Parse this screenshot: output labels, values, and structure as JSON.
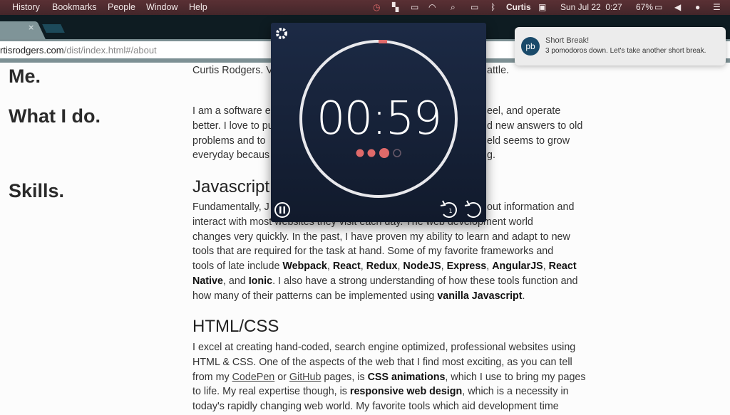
{
  "menubar": {
    "items": [
      "History",
      "Bookmarks",
      "People",
      "Window",
      "Help"
    ],
    "user": "Curtis",
    "datetime": "Sun Jul 22  0:27",
    "battery": "67%"
  },
  "browser": {
    "tab_close": "×",
    "url_host": "rtisrodgers.com",
    "url_path": "/dist/index.html#/about"
  },
  "sidebar": {
    "me": "Me.",
    "what": "What I do.",
    "skills": "Skills."
  },
  "content": {
    "intro": [
      {
        "l": "Curtis Rodgers. V",
        "r": "attle."
      }
    ],
    "what": [
      {
        "l": "I am a software e",
        "r": "eel, and operate"
      },
      {
        "l": "better. I love to pu",
        "r": "d new answers to old"
      },
      {
        "l": "problems and to",
        "r": "eld seems to grow"
      },
      {
        "l": "everyday becaus",
        "r": "g."
      }
    ],
    "js_heading": "Javascript",
    "js_lines": [
      [
        {
          "t": "Fundamentally, J"
        }
      ],
      [
        {
          "t": "interact with most websites they visit each day. The web development world"
        }
      ],
      [
        {
          "t": "changes very quickly. In the past, I have proven my ability to learn and adapt to new"
        }
      ],
      [
        {
          "t": "tools that are required for the task at hand. Some of my favorite frameworks and"
        }
      ],
      [
        {
          "t": "tools of late include "
        },
        {
          "t": "Webpack",
          "b": 1
        },
        {
          "t": ", "
        },
        {
          "t": "React",
          "b": 1
        },
        {
          "t": ", "
        },
        {
          "t": "Redux",
          "b": 1
        },
        {
          "t": ", "
        },
        {
          "t": "NodeJS",
          "b": 1
        },
        {
          "t": ", "
        },
        {
          "t": "Express",
          "b": 1
        },
        {
          "t": ", "
        },
        {
          "t": "AngularJS",
          "b": 1
        },
        {
          "t": ", "
        },
        {
          "t": "React",
          "b": 1
        }
      ],
      [
        {
          "t": "Native",
          "b": 1
        },
        {
          "t": ", and "
        },
        {
          "t": "Ionic",
          "b": 1
        },
        {
          "t": ". I also have a strong understanding of how these tools function and"
        }
      ],
      [
        {
          "t": "how many of their patterns can be implemented using "
        },
        {
          "t": "vanilla Javascript",
          "b": 1
        },
        {
          "t": "."
        }
      ]
    ],
    "js_first_right": "out information and",
    "html_heading": "HTML/CSS",
    "html_lines": [
      [
        {
          "t": "I excel at creating hand-coded, search engine optimized, professional websites using"
        }
      ],
      [
        {
          "t": "HTML & CSS. One of the aspects of the web that I find most exciting, as you can tell"
        }
      ],
      [
        {
          "t": "from my "
        },
        {
          "t": "CodePen",
          "a": 1
        },
        {
          "t": " or "
        },
        {
          "t": "GitHub",
          "a": 1
        },
        {
          "t": " pages, is "
        },
        {
          "t": "CSS animations",
          "b": 1
        },
        {
          "t": ", which I use to bring my pages"
        }
      ],
      [
        {
          "t": "to life. My real expertise though, is "
        },
        {
          "t": "responsive web design",
          "b": 1
        },
        {
          "t": ", which is a necessity in"
        }
      ],
      [
        {
          "t": "today's rapidly changing web world. My favorite tools which aid development time"
        }
      ]
    ]
  },
  "timer": {
    "time": "00:59",
    "pomodoros_done": 3,
    "pomodoros_total": 4,
    "accent": "#e06a6a",
    "reset_count": "1"
  },
  "notification": {
    "icon_text": "pb",
    "title": "Short Break!",
    "message": "3 pomodoros down. Let's take another short break."
  }
}
